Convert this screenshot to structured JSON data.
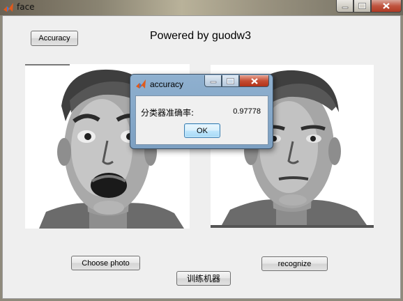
{
  "window": {
    "title": "face",
    "icon": "matlab-logo-icon",
    "controls": [
      "minimize",
      "maximize",
      "close"
    ]
  },
  "main": {
    "accuracy_button": "Accuracy",
    "powered_text": "Powered by guodw3",
    "choose_photo_button": "Choose photo",
    "recognize_button": "recognize",
    "train_button": "训练机器"
  },
  "dialog": {
    "title": "accuracy",
    "label": "分类器准确率:",
    "value": "0.97778",
    "ok_button": "OK"
  },
  "colors": {
    "client_bg": "#efefef",
    "dialog_frame": "#8fb0cf",
    "close_red": "#c0543f"
  }
}
